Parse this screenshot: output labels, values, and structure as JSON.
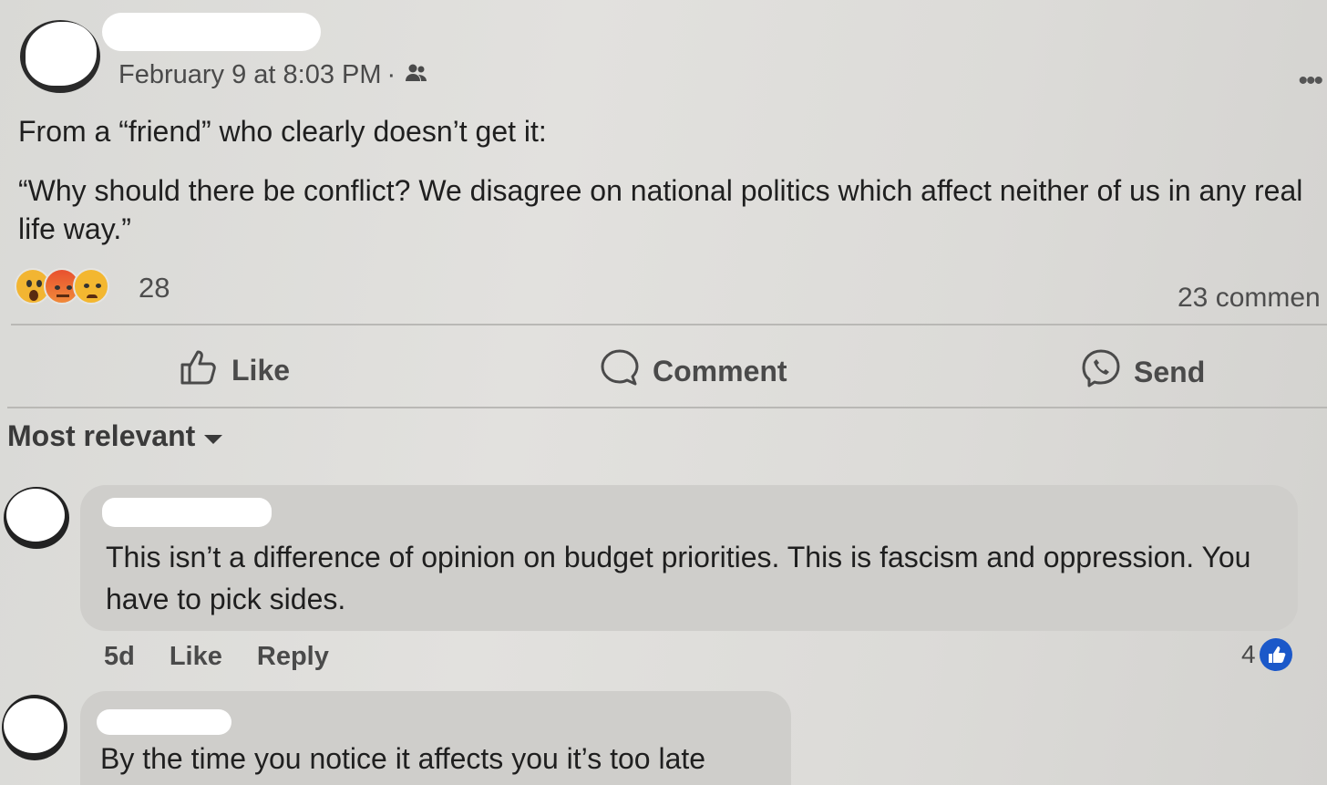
{
  "post": {
    "timestamp": "February 9 at 8:03 PM",
    "separator": "·",
    "audience_icon": "friends-icon",
    "more_icon": "more-options-icon",
    "body_line1": "From a “friend” who clearly doesn’t get it:",
    "body_quote": "“Why should there be conflict? We disagree on national politics which affect neither of us in any real life way.”",
    "reactions": [
      "wow-emoji-icon",
      "angry-emoji-icon",
      "sad-emoji-icon"
    ],
    "reaction_count": "28",
    "comment_count": "23 commen"
  },
  "actions": {
    "like_label": "Like",
    "comment_label": "Comment",
    "send_label": "Send"
  },
  "sort": {
    "label": "Most relevant"
  },
  "comments": [
    {
      "text": "This isn’t a difference of opinion on budget priorities. This is fascism and oppression. You have to pick sides.",
      "age": "5d",
      "like_label": "Like",
      "reply_label": "Reply",
      "like_count": "4"
    },
    {
      "text": "By the time you notice it affects you it’s too late"
    }
  ],
  "colors": {
    "accent": "#1b58c9",
    "background": "#dddcd9",
    "bubble": "#cfcecb"
  }
}
